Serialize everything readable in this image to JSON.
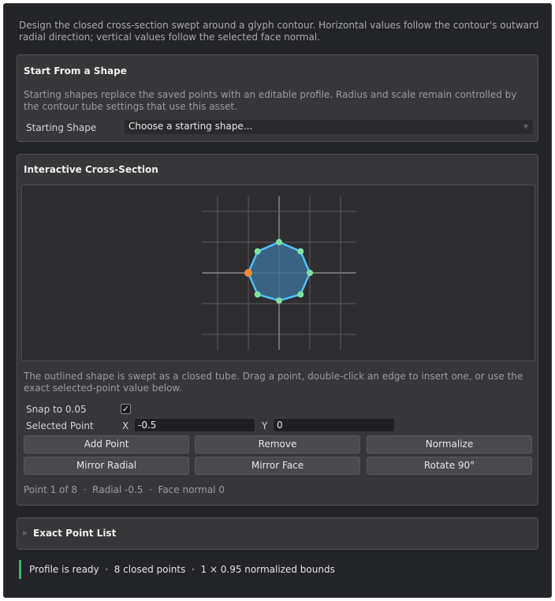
{
  "intro": "Design the closed cross-section swept around a glyph contour. Horizontal values follow the contour's outward radial direction; vertical values follow the selected face normal.",
  "start_panel": {
    "title": "Start From a Shape",
    "description": "Starting shapes replace the saved points with an editable profile. Radius and scale remain controlled by the contour tube settings that use this asset.",
    "shape_label": "Starting Shape",
    "shape_value": "Choose a starting shape..."
  },
  "cross_section": {
    "title": "Interactive Cross-Section",
    "description": "The outlined shape is swept as a closed tube. Drag a point, double-click an edge to insert one, or use the exact selected-point value below.",
    "snap_label": "Snap to 0.05",
    "snap_checked": true,
    "selected_label": "Selected Point",
    "x_label": "X",
    "x_value": "-0.5",
    "y_label": "Y",
    "y_value": "0",
    "buttons": {
      "add_point": "Add Point",
      "remove": "Remove",
      "normalize": "Normalize",
      "mirror_radial": "Mirror Radial",
      "mirror_face": "Mirror Face",
      "rotate": "Rotate 90°"
    },
    "info": "Point 1 of 8  ·  Radial -0.5  ·  Face normal 0",
    "selected_index": 0,
    "colors": {
      "outline": "#4fc3f7",
      "fill": "#3b6d93",
      "point": "#7fe3a0",
      "selected_point": "#f4883a",
      "grid": "#5a5a5e",
      "axis": "#8a8a8e"
    },
    "points": [
      {
        "x": -0.5,
        "y": 0
      },
      {
        "x": -0.35,
        "y": 0.35
      },
      {
        "x": 0,
        "y": 0.5
      },
      {
        "x": 0.35,
        "y": 0.35
      },
      {
        "x": 0.5,
        "y": 0
      },
      {
        "x": 0.35,
        "y": -0.35
      },
      {
        "x": 0,
        "y": -0.45
      },
      {
        "x": -0.35,
        "y": -0.35
      }
    ],
    "grid_range": [
      -1,
      1
    ],
    "grid_step": 0.5
  },
  "exact_panel": {
    "title": "Exact Point List",
    "expand_icon": "triangle-right-icon"
  },
  "status": {
    "text": "Profile is ready  ·  8 closed points  ·  1 × 0.95 normalized bounds",
    "accent": "#38b96b"
  }
}
